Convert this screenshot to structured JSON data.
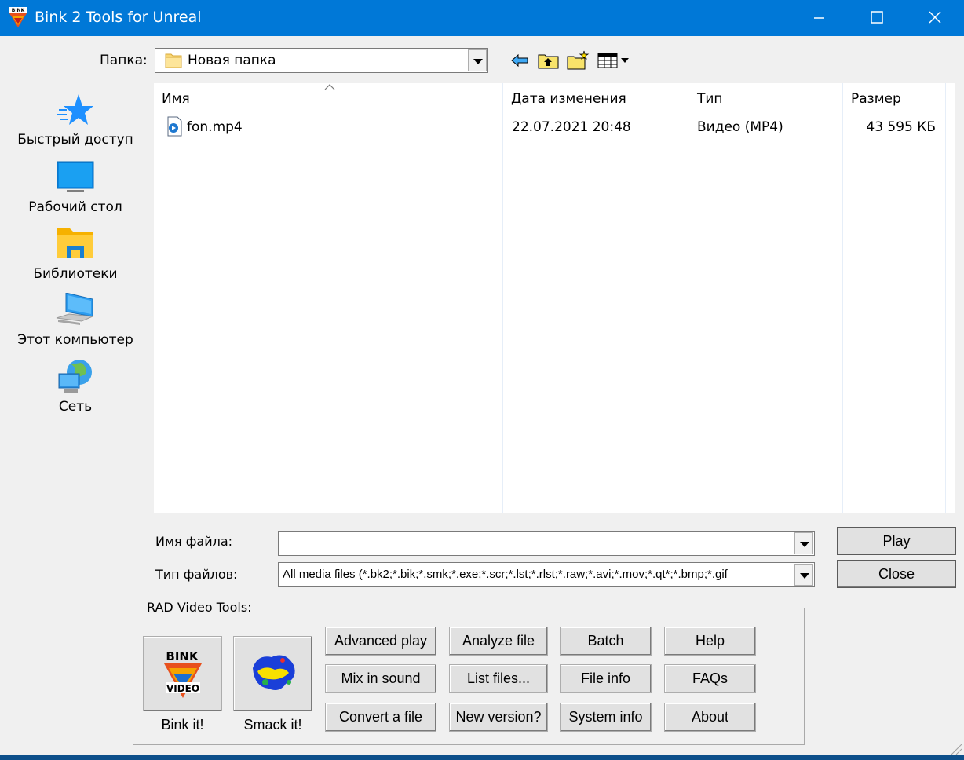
{
  "window": {
    "title": "Bink 2 Tools for Unreal"
  },
  "folder": {
    "label": "Папка:",
    "current": "Новая папка"
  },
  "places": [
    {
      "label": "Быстрый доступ",
      "icon": "star-icon"
    },
    {
      "label": "Рабочий стол",
      "icon": "desktop-icon"
    },
    {
      "label": "Библиотеки",
      "icon": "libraries-icon"
    },
    {
      "label": "Этот компьютер",
      "icon": "computer-icon"
    },
    {
      "label": "Сеть",
      "icon": "network-icon"
    }
  ],
  "file_list": {
    "columns": [
      "Имя",
      "Дата изменения",
      "Тип",
      "Размер"
    ],
    "rows": [
      {
        "name": "fon.mp4",
        "date": "22.07.2021 20:48",
        "type": "Видео (MP4)",
        "size": "43 595 КБ"
      }
    ]
  },
  "filename": {
    "label": "Имя файла:",
    "value": ""
  },
  "filetype": {
    "label": "Тип файлов:",
    "value": "All media files (*.bk2;*.bik;*.smk;*.exe;*.scr;*.lst;*.rlst;*.raw;*.avi;*.mov;*.qt*;*.bmp;*.gif"
  },
  "buttons": {
    "play": "Play",
    "close": "Close"
  },
  "rad_tools": {
    "title": "RAD Video Tools:",
    "bink_label": "Bink it!",
    "smack_label": "Smack it!",
    "grid": [
      [
        "Advanced play",
        "Analyze file",
        "Batch",
        "Help"
      ],
      [
        "Mix in sound",
        "List files...",
        "File info",
        "FAQs"
      ],
      [
        "Convert a file",
        "New version?",
        "System info",
        "About"
      ]
    ]
  },
  "colors": {
    "titlebar": "#0078d7",
    "accent": "#0078d7"
  }
}
